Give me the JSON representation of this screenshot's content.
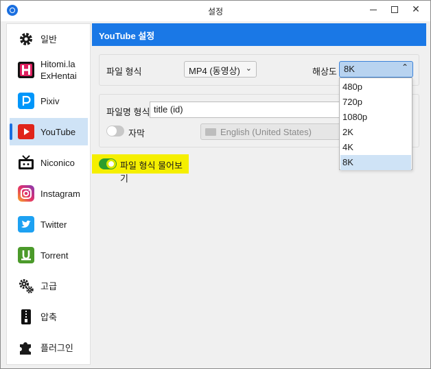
{
  "window": {
    "title": "설정"
  },
  "sidebar": {
    "items": [
      {
        "label": "일반",
        "icon": "gear-icon"
      },
      {
        "label": "Hitomi.la\nExHentai",
        "label_line1": "Hitomi.la",
        "label_line2": "ExHentai",
        "icon": "hitomi-icon"
      },
      {
        "label": "Pixiv",
        "icon": "pixiv-icon"
      },
      {
        "label": "YouTube",
        "icon": "youtube-icon"
      },
      {
        "label": "Niconico",
        "icon": "niconico-icon"
      },
      {
        "label": "Instagram",
        "icon": "instagram-icon"
      },
      {
        "label": "Twitter",
        "icon": "twitter-icon"
      },
      {
        "label": "Torrent",
        "icon": "torrent-icon"
      },
      {
        "label": "고급",
        "icon": "gears-icon"
      },
      {
        "label": "압축",
        "icon": "zip-icon"
      },
      {
        "label": "플러그인",
        "icon": "puzzle-icon"
      }
    ],
    "active_index": 3
  },
  "header": {
    "title": "YouTube 설정"
  },
  "format": {
    "label": "파일 형식",
    "value": "MP4  (동영상)"
  },
  "resolution": {
    "label": "해상도",
    "value": "8K",
    "options": [
      "480p",
      "720p",
      "1080p",
      "2K",
      "4K",
      "8K"
    ],
    "selected": "8K"
  },
  "filename": {
    "label": "파일명 형식",
    "value": "title (id)"
  },
  "subtitle": {
    "label": "자막",
    "enabled": false,
    "language": "English (United States)"
  },
  "ask_format": {
    "label": "파일 형식 물어보기",
    "enabled": true
  },
  "colors": {
    "accent": "#1a78e6",
    "highlight": "#f5ef00",
    "selection": "#cfe3f6"
  }
}
